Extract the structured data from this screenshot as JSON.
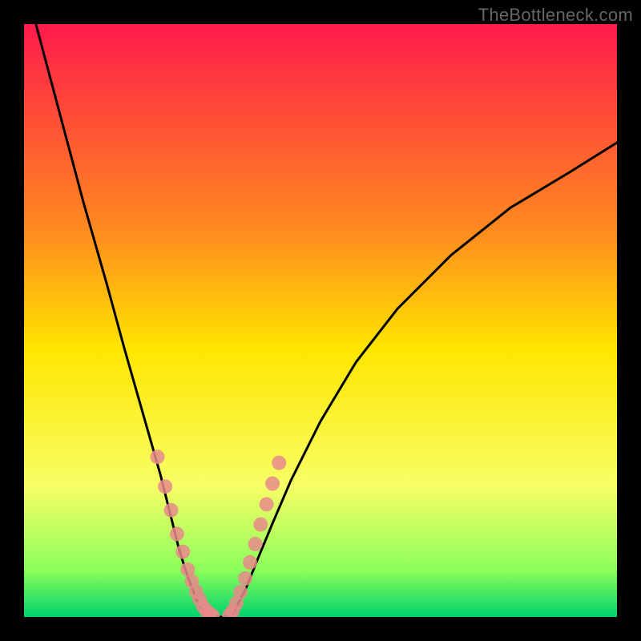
{
  "watermark": "TheBottleneck.com",
  "chart_data": {
    "type": "line",
    "title": "",
    "xlabel": "",
    "ylabel": "",
    "xlim": [
      0,
      100
    ],
    "ylim": [
      0,
      100
    ],
    "grid": false,
    "background_gradient": {
      "stops": [
        {
          "y": 0,
          "color": "#ff1b4a"
        },
        {
          "y": 35,
          "color": "#ff8b1f"
        },
        {
          "y": 55,
          "color": "#ffe600"
        },
        {
          "y": 78,
          "color": "#f7ff66"
        },
        {
          "y": 92,
          "color": "#8cff5a"
        },
        {
          "y": 100,
          "color": "#00d36b"
        }
      ]
    },
    "series": [
      {
        "name": "bottleneck-curve-left",
        "type": "line",
        "color": "#000000",
        "x": [
          2,
          6,
          10,
          14,
          17,
          19,
          21,
          23,
          24.5,
          26,
          27.2,
          28.3,
          29.3,
          30.2,
          31
        ],
        "y": [
          100,
          85,
          70,
          56,
          45,
          38,
          31,
          24,
          18,
          12,
          8,
          5,
          2.5,
          1,
          0
        ]
      },
      {
        "name": "bottleneck-curve-right",
        "type": "line",
        "color": "#000000",
        "x": [
          35,
          36,
          37.5,
          39.5,
          42,
          45,
          50,
          56,
          63,
          72,
          82,
          92,
          100
        ],
        "y": [
          0,
          2,
          5,
          10,
          16,
          23,
          33,
          43,
          52,
          61,
          69,
          75,
          80
        ]
      },
      {
        "name": "floor",
        "type": "line",
        "color": "#000000",
        "x": [
          31,
          35
        ],
        "y": [
          0,
          0
        ]
      },
      {
        "name": "markers-left",
        "type": "scatter",
        "color": "#e88a8a",
        "x": [
          22.5,
          23.8,
          24.8,
          25.8,
          26.8,
          27.6,
          28.3,
          29.0,
          29.6,
          30.2,
          30.8,
          31.3,
          31.8
        ],
        "y": [
          27,
          22,
          18,
          14,
          11,
          8,
          6,
          4.3,
          3,
          1.8,
          1,
          0.5,
          0.2
        ]
      },
      {
        "name": "markers-right",
        "type": "scatter",
        "color": "#e88a8a",
        "x": [
          34.6,
          35.2,
          35.8,
          36.5,
          37.3,
          38.1,
          39.0,
          39.9,
          40.9,
          41.9,
          43.0
        ],
        "y": [
          0.2,
          1,
          2.3,
          4.2,
          6.5,
          9.2,
          12.3,
          15.6,
          19.0,
          22.5,
          26
        ]
      }
    ]
  }
}
